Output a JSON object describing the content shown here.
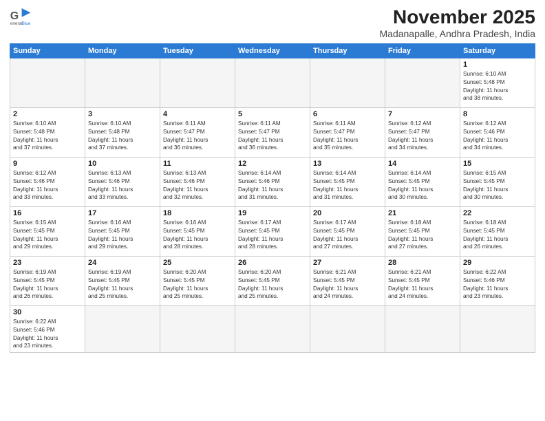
{
  "logo": {
    "line1": "General",
    "line2": "Blue"
  },
  "title": "November 2025",
  "location": "Madanapalle, Andhra Pradesh, India",
  "weekdays": [
    "Sunday",
    "Monday",
    "Tuesday",
    "Wednesday",
    "Thursday",
    "Friday",
    "Saturday"
  ],
  "weeks": [
    [
      {
        "day": "",
        "info": ""
      },
      {
        "day": "",
        "info": ""
      },
      {
        "day": "",
        "info": ""
      },
      {
        "day": "",
        "info": ""
      },
      {
        "day": "",
        "info": ""
      },
      {
        "day": "",
        "info": ""
      },
      {
        "day": "1",
        "info": "Sunrise: 6:10 AM\nSunset: 5:48 PM\nDaylight: 11 hours\nand 38 minutes."
      }
    ],
    [
      {
        "day": "2",
        "info": "Sunrise: 6:10 AM\nSunset: 5:48 PM\nDaylight: 11 hours\nand 37 minutes."
      },
      {
        "day": "3",
        "info": "Sunrise: 6:10 AM\nSunset: 5:48 PM\nDaylight: 11 hours\nand 37 minutes."
      },
      {
        "day": "4",
        "info": "Sunrise: 6:11 AM\nSunset: 5:47 PM\nDaylight: 11 hours\nand 36 minutes."
      },
      {
        "day": "5",
        "info": "Sunrise: 6:11 AM\nSunset: 5:47 PM\nDaylight: 11 hours\nand 36 minutes."
      },
      {
        "day": "6",
        "info": "Sunrise: 6:11 AM\nSunset: 5:47 PM\nDaylight: 11 hours\nand 35 minutes."
      },
      {
        "day": "7",
        "info": "Sunrise: 6:12 AM\nSunset: 5:47 PM\nDaylight: 11 hours\nand 34 minutes."
      },
      {
        "day": "8",
        "info": "Sunrise: 6:12 AM\nSunset: 5:46 PM\nDaylight: 11 hours\nand 34 minutes."
      }
    ],
    [
      {
        "day": "9",
        "info": "Sunrise: 6:12 AM\nSunset: 5:46 PM\nDaylight: 11 hours\nand 33 minutes."
      },
      {
        "day": "10",
        "info": "Sunrise: 6:13 AM\nSunset: 5:46 PM\nDaylight: 11 hours\nand 33 minutes."
      },
      {
        "day": "11",
        "info": "Sunrise: 6:13 AM\nSunset: 5:46 PM\nDaylight: 11 hours\nand 32 minutes."
      },
      {
        "day": "12",
        "info": "Sunrise: 6:14 AM\nSunset: 5:46 PM\nDaylight: 11 hours\nand 31 minutes."
      },
      {
        "day": "13",
        "info": "Sunrise: 6:14 AM\nSunset: 5:45 PM\nDaylight: 11 hours\nand 31 minutes."
      },
      {
        "day": "14",
        "info": "Sunrise: 6:14 AM\nSunset: 5:45 PM\nDaylight: 11 hours\nand 30 minutes."
      },
      {
        "day": "15",
        "info": "Sunrise: 6:15 AM\nSunset: 5:45 PM\nDaylight: 11 hours\nand 30 minutes."
      }
    ],
    [
      {
        "day": "16",
        "info": "Sunrise: 6:15 AM\nSunset: 5:45 PM\nDaylight: 11 hours\nand 29 minutes."
      },
      {
        "day": "17",
        "info": "Sunrise: 6:16 AM\nSunset: 5:45 PM\nDaylight: 11 hours\nand 29 minutes."
      },
      {
        "day": "18",
        "info": "Sunrise: 6:16 AM\nSunset: 5:45 PM\nDaylight: 11 hours\nand 28 minutes."
      },
      {
        "day": "19",
        "info": "Sunrise: 6:17 AM\nSunset: 5:45 PM\nDaylight: 11 hours\nand 28 minutes."
      },
      {
        "day": "20",
        "info": "Sunrise: 6:17 AM\nSunset: 5:45 PM\nDaylight: 11 hours\nand 27 minutes."
      },
      {
        "day": "21",
        "info": "Sunrise: 6:18 AM\nSunset: 5:45 PM\nDaylight: 11 hours\nand 27 minutes."
      },
      {
        "day": "22",
        "info": "Sunrise: 6:18 AM\nSunset: 5:45 PM\nDaylight: 11 hours\nand 26 minutes."
      }
    ],
    [
      {
        "day": "23",
        "info": "Sunrise: 6:19 AM\nSunset: 5:45 PM\nDaylight: 11 hours\nand 26 minutes."
      },
      {
        "day": "24",
        "info": "Sunrise: 6:19 AM\nSunset: 5:45 PM\nDaylight: 11 hours\nand 25 minutes."
      },
      {
        "day": "25",
        "info": "Sunrise: 6:20 AM\nSunset: 5:45 PM\nDaylight: 11 hours\nand 25 minutes."
      },
      {
        "day": "26",
        "info": "Sunrise: 6:20 AM\nSunset: 5:45 PM\nDaylight: 11 hours\nand 25 minutes."
      },
      {
        "day": "27",
        "info": "Sunrise: 6:21 AM\nSunset: 5:45 PM\nDaylight: 11 hours\nand 24 minutes."
      },
      {
        "day": "28",
        "info": "Sunrise: 6:21 AM\nSunset: 5:45 PM\nDaylight: 11 hours\nand 24 minutes."
      },
      {
        "day": "29",
        "info": "Sunrise: 6:22 AM\nSunset: 5:46 PM\nDaylight: 11 hours\nand 23 minutes."
      }
    ],
    [
      {
        "day": "30",
        "info": "Sunrise: 6:22 AM\nSunset: 5:46 PM\nDaylight: 11 hours\nand 23 minutes."
      },
      {
        "day": "",
        "info": ""
      },
      {
        "day": "",
        "info": ""
      },
      {
        "day": "",
        "info": ""
      },
      {
        "day": "",
        "info": ""
      },
      {
        "day": "",
        "info": ""
      },
      {
        "day": "",
        "info": ""
      }
    ]
  ]
}
